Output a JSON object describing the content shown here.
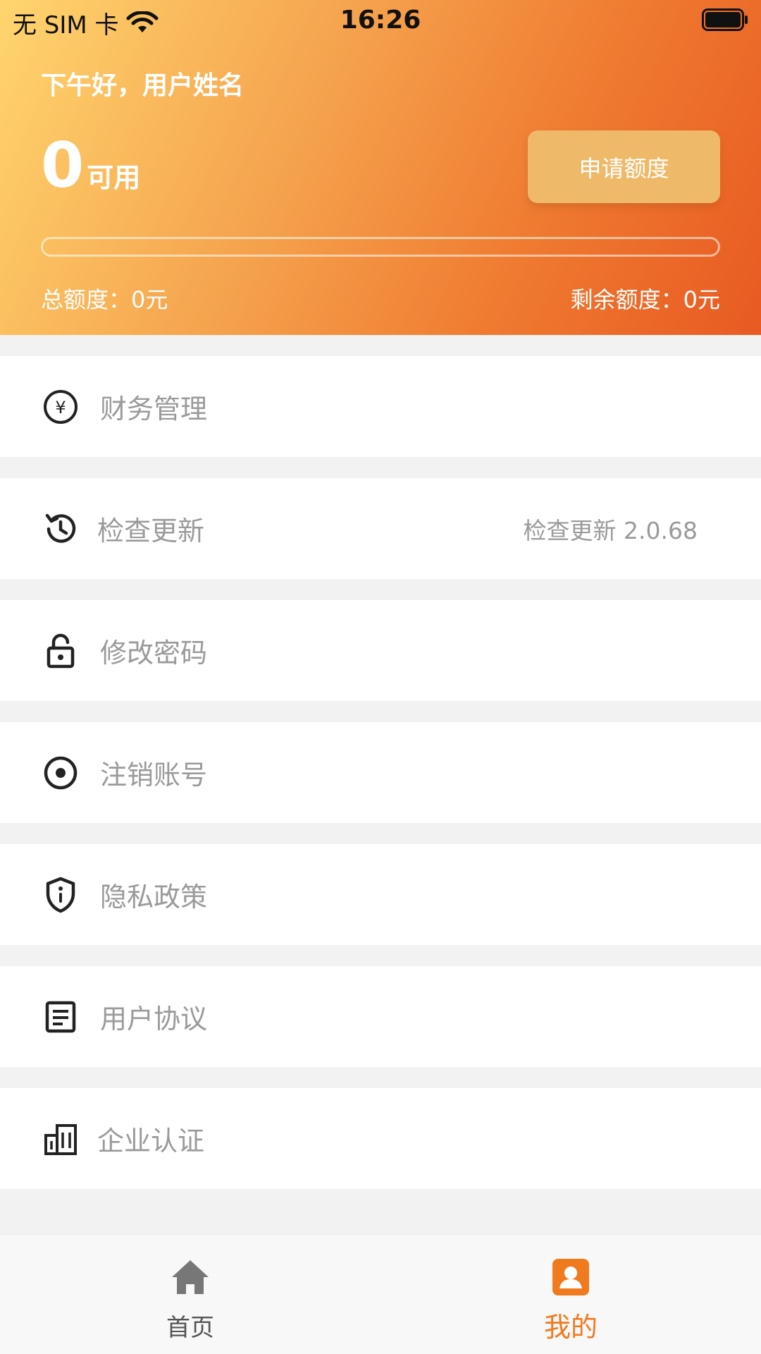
{
  "status_bar": {
    "carrier": "无 SIM 卡",
    "time": "16:26"
  },
  "header": {
    "greeting": "下午好，用户姓名",
    "available_amount": "0",
    "available_label": "可用",
    "apply_button_label": "申请额度",
    "progress_fraction": 0,
    "total_quota": "总额度：0元",
    "remaining_quota": "剩余额度：0元"
  },
  "menu": {
    "items": [
      {
        "label": "财务管理",
        "icon": "yen-circle-icon"
      },
      {
        "label": "检查更新",
        "icon": "history-icon",
        "extra": "检查更新 2.0.68"
      },
      {
        "label": "修改密码",
        "icon": "lock-icon"
      },
      {
        "label": "注销账号",
        "icon": "radio-dot-icon"
      },
      {
        "label": "隐私政策",
        "icon": "shield-info-icon"
      },
      {
        "label": "用户协议",
        "icon": "document-icon"
      },
      {
        "label": "企业认证",
        "icon": "building-icon"
      }
    ]
  },
  "tab_bar": {
    "tabs": [
      {
        "label": "首页",
        "icon": "home-icon",
        "active": false
      },
      {
        "label": "我的",
        "icon": "profile-icon",
        "active": true
      }
    ]
  },
  "colors": {
    "accent": "#f07a1e",
    "apply_button": "#efb96a",
    "menu_text": "#9a9a9a"
  }
}
